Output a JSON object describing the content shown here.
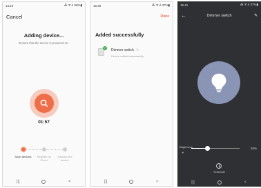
{
  "screen1": {
    "status_time": "14:10",
    "status_right": "⁂ ᯤ.ıl 66%▮",
    "cancel_label": "Cancel",
    "title": "Adding device...",
    "subtitle": "Ensure that the device is powered on.",
    "timer": "01:57",
    "steps": [
      {
        "label": "Scan devices.",
        "state": "active"
      },
      {
        "label": "Register on Cloud.",
        "state": "pending"
      },
      {
        "label": "Initialize the device.",
        "state": "pending"
      }
    ],
    "accent_color": "#ef6e4a"
  },
  "screen2": {
    "status_time": "15:40",
    "status_right": "⁂ ᯤ.ıl 37%▮",
    "done_label": "Done",
    "title": "Added successfully",
    "device": {
      "name": "Dimmer switch",
      "status": "Device added successfully"
    },
    "success_color": "#38b449"
  },
  "screen3": {
    "status_time": "15:41",
    "status_right": "⁂ ᯤ.ıl 37%▮",
    "title": "Dimmer switch",
    "brightness_label": "Brightness",
    "brightness_percent": 34,
    "brightness_text": "34%",
    "schedule_label": "Schedule",
    "bulb_color": "#8a95b5",
    "background_color": "#2f3033"
  },
  "icons": {
    "back": "←",
    "edit": "✎",
    "nav_recent": "|||",
    "nav_back": "<",
    "check": "✓",
    "search": "search-icon",
    "bulb": "bulb-icon",
    "clock": "clock-icon",
    "sun": "☀"
  }
}
